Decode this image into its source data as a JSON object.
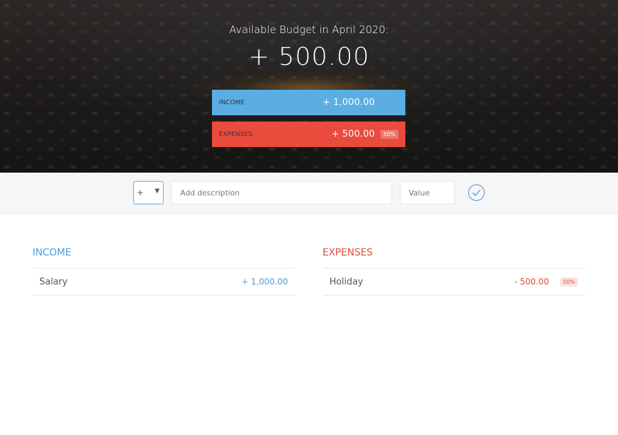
{
  "header": {
    "title": "Available Budget in April 2020:",
    "budget": "+ 500.00",
    "income": {
      "label": "Income",
      "value": "+ 1,000.00"
    },
    "expenses": {
      "label": "Expenses",
      "value": "+ 500.00",
      "percentage": "50%"
    }
  },
  "add_bar": {
    "type_value": "+",
    "description_placeholder": "Add description",
    "value_placeholder": "Value"
  },
  "income_list": {
    "title": "Income",
    "items": [
      {
        "description": "Salary",
        "value": "+ 1,000.00"
      }
    ]
  },
  "expenses_list": {
    "title": "Expenses",
    "items": [
      {
        "description": "Holiday",
        "value": "- 500.00",
        "percentage": "50%"
      }
    ]
  },
  "colors": {
    "income": "#5aaee3",
    "expenses": "#e94b3c"
  }
}
